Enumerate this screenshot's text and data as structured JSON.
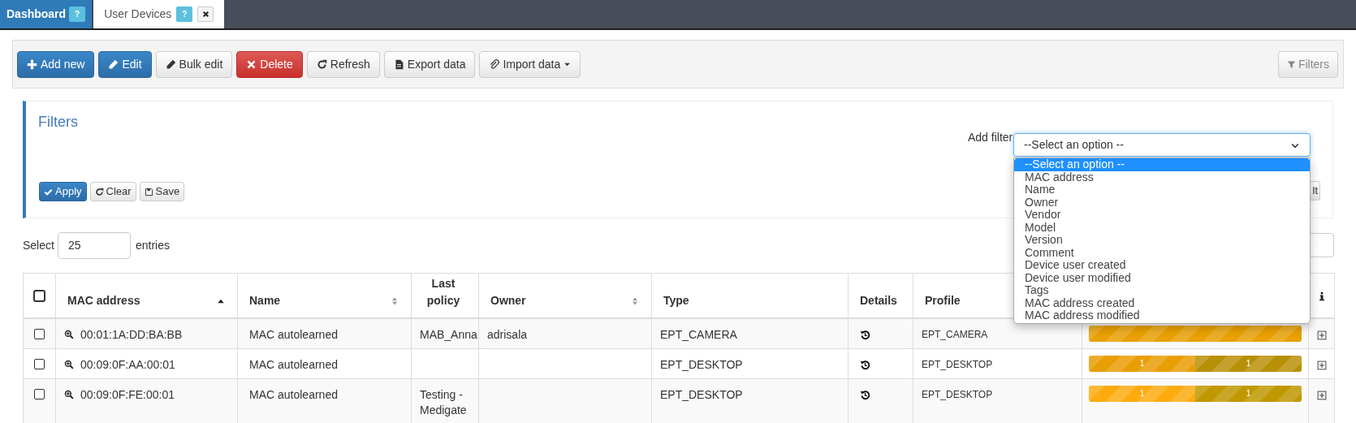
{
  "tabs": [
    {
      "label": "Dashboard",
      "help": "?",
      "selected": false,
      "closable": false
    },
    {
      "label": "User Devices",
      "help": "?",
      "selected": true,
      "closable": true
    }
  ],
  "toolbar": {
    "buttons": [
      {
        "label": "Add new",
        "kind": "primary"
      },
      {
        "label": "Edit",
        "kind": "primary"
      },
      {
        "label": "Bulk edit",
        "kind": "default"
      },
      {
        "label": "Delete",
        "kind": "danger"
      },
      {
        "label": "Refresh",
        "kind": "default"
      },
      {
        "label": "Export data",
        "kind": "default"
      },
      {
        "label": "Import data",
        "kind": "default",
        "caret": true
      }
    ],
    "filters_button": {
      "label": "Filters",
      "disabled": true
    }
  },
  "filters": {
    "title": "Filters",
    "add_filter_label": "Add filter",
    "select": {
      "value": "--Select an option --"
    },
    "dropdown": {
      "expanded": true,
      "options": [
        {
          "label": "--Select an option --",
          "selected": true
        },
        {
          "label": "MAC address",
          "selected": false
        },
        {
          "label": "Name",
          "selected": false
        },
        {
          "label": "Owner",
          "selected": false
        },
        {
          "label": "Vendor",
          "selected": false
        },
        {
          "label": "Model",
          "selected": false
        },
        {
          "label": "Version",
          "selected": false
        },
        {
          "label": "Comment",
          "selected": false
        },
        {
          "label": "Device user created",
          "selected": false
        },
        {
          "label": "Device user modified",
          "selected": false
        },
        {
          "label": "Tags",
          "selected": false
        },
        {
          "label": "MAC address created",
          "selected": false
        },
        {
          "label": "MAC address modified",
          "selected": false
        }
      ]
    },
    "buttons": [
      {
        "label": "Apply",
        "kind": "primary"
      },
      {
        "label": "Clear",
        "kind": "default"
      },
      {
        "label": "Save",
        "kind": "default"
      }
    ],
    "partial_button": "lt"
  },
  "entries": {
    "prefix": "Select",
    "value": "25",
    "suffix": "entries"
  },
  "table": {
    "header_checked": false,
    "columns": [
      {
        "label": "MAC address",
        "sortable": true,
        "sorted": true
      },
      {
        "label": "Name",
        "sortable": true,
        "sorted": false
      },
      {
        "label": "Last policy"
      },
      {
        "label": "Owner",
        "sortable": true,
        "sorted": false
      },
      {
        "label": "Type"
      },
      {
        "label": "Details"
      },
      {
        "label": "Profile"
      },
      {
        "kind": "info"
      }
    ],
    "rows": [
      {
        "checked": false,
        "mac": "00:01:1A:DD:BA:BB",
        "name": "MAC autolearned",
        "last_policy": "MAB_Anna",
        "owner": "adrisala",
        "type": "EPT_CAMERA",
        "profile": "EPT_CAMERA",
        "bar": [
          {
            "level": 1,
            "color": "#e9a000"
          }
        ]
      },
      {
        "checked": false,
        "mac": "00:09:0F:AA:00:01",
        "name": "MAC autolearned",
        "type": "EPT_DESKTOP",
        "profile": "EPT_DESKTOP",
        "bar": [
          {
            "level": 0.5,
            "color": "#e99e05",
            "label": "1"
          },
          {
            "level": 0.5,
            "color": "#b89007",
            "label": "1"
          }
        ]
      },
      {
        "checked": false,
        "mac": "00:09:0F:FE:00:01",
        "name": "MAC autolearned",
        "last_policy": "Testing - Medigate",
        "type": "EPT_DESKTOP",
        "profile": "EPT_DESKTOP",
        "bar": [
          {
            "level": 0.5,
            "color": "#fdab0f",
            "label": "1"
          },
          {
            "level": 0.5,
            "color": "#c09800",
            "label": "1"
          }
        ]
      }
    ]
  }
}
